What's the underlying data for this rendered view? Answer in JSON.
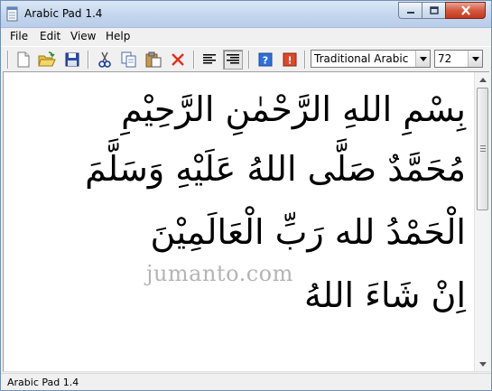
{
  "window": {
    "title": "Arabic Pad 1.4"
  },
  "menu": {
    "items": [
      "File",
      "Edit",
      "View",
      "Help"
    ]
  },
  "toolbar": {
    "buttons": [
      "new-file-icon",
      "open-folder-icon",
      "save-icon",
      "cut-icon",
      "copy-icon",
      "paste-icon",
      "delete-icon",
      "align-left-icon",
      "align-right-icon",
      "help-icon",
      "about-icon"
    ],
    "font": "Traditional Arabic",
    "size": "72"
  },
  "editor": {
    "lines": [
      "بِسْمِ اللهِ الرَّحْمٰنِ الرَّحِيْمِ",
      "مُحَمَّدٌ صَلَّى اللهُ عَلَيْهِ وَسَلَّمَ",
      "الْحَمْدُ لله رَبِّ الْعَالَمِيْنَ",
      "اِنْ شَاءَ اللهُ"
    ],
    "watermark": "jumanto.com"
  },
  "status": {
    "text": "Arabic Pad 1.4"
  }
}
